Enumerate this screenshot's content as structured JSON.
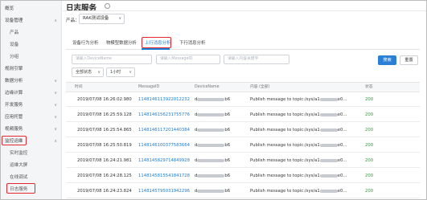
{
  "sidebar": {
    "items": [
      {
        "label": "概览",
        "indent": false,
        "chev": ""
      },
      {
        "label": "设备管理",
        "indent": false,
        "chev": "∧"
      },
      {
        "label": "产品",
        "indent": true,
        "chev": ""
      },
      {
        "label": "设备",
        "indent": true,
        "chev": ""
      },
      {
        "label": "分组",
        "indent": true,
        "chev": ""
      },
      {
        "label": "规则引擎",
        "indent": false,
        "chev": ""
      },
      {
        "label": "数据分析",
        "indent": false,
        "chev": "∨"
      },
      {
        "label": "边缘计算",
        "indent": false,
        "chev": "∨"
      },
      {
        "label": "开发服务",
        "indent": false,
        "chev": "∨"
      },
      {
        "label": "应用托管",
        "indent": false,
        "chev": "∨"
      },
      {
        "label": "视频服务",
        "indent": false,
        "chev": "∨"
      },
      {
        "label": "监控运维",
        "indent": false,
        "chev": "∧"
      },
      {
        "label": "实时监控",
        "indent": true,
        "chev": ""
      },
      {
        "label": "运维大屏",
        "indent": true,
        "chev": ""
      },
      {
        "label": "在线调试",
        "indent": true,
        "chev": ""
      },
      {
        "label": "日志服务",
        "indent": true,
        "chev": ""
      }
    ]
  },
  "header": {
    "title": "日志服务",
    "product_label": "产品：",
    "product_value": "RAK测试设备"
  },
  "tabs": [
    {
      "label": "设备行为分析",
      "active": false
    },
    {
      "label": "物模型数据分析",
      "active": false
    },
    {
      "label": "上行消息分析",
      "active": true
    },
    {
      "label": "下行消息分析",
      "active": false
    }
  ],
  "filters": {
    "devicename_placeholder": "请输入DeviceName",
    "messageid_placeholder": "请输入MessageID",
    "content_placeholder": "请输入内容关键字",
    "status_value": "全部状态",
    "time_value": "1小时",
    "search_label": "搜索",
    "reset_label": "重置"
  },
  "table": {
    "headers": {
      "time": "时间",
      "messageid": "MessageID",
      "devicename": "DeviceName",
      "content": "内容 (全部)",
      "status": "状态"
    },
    "rows": [
      {
        "time": "2019/07/08 16:26:02.980",
        "messageid": "1148146113922012232",
        "device_prefix": "d",
        "device_suffix": "b6",
        "content_prefix": "Publish message to topic:/sys/a1",
        "content_suffix": "e0...",
        "status": "200"
      },
      {
        "time": "2019/07/08 16:25:59.128",
        "messageid": "1148146156231755776",
        "device_prefix": "d",
        "device_suffix": "b6",
        "content_prefix": "Publish message to topic:/sys/a1",
        "content_suffix": "e0...",
        "status": "200"
      },
      {
        "time": "2019/07/08 16:25:54.865",
        "messageid": "1148146117201440384",
        "device_prefix": "d",
        "device_suffix": "b6",
        "content_prefix": "Publish message to topic:/sys/a1",
        "content_suffix": "e0...",
        "status": "200"
      },
      {
        "time": "2019/07/08 16:25:50.819",
        "messageid": "1148146100377583664",
        "device_prefix": "d",
        "device_suffix": "b6",
        "content_prefix": "Publish message to topic:/sys/a1",
        "content_suffix": "e0...",
        "status": "200"
      },
      {
        "time": "2019/07/08 16:24:21.981",
        "messageid": "1148145829714849928",
        "device_prefix": "d",
        "device_suffix": "b6",
        "content_prefix": "Publish message to topic:/sys/a1",
        "content_suffix": "e0...",
        "status": "200"
      },
      {
        "time": "2019/07/08 16:24:28.125",
        "messageid": "1148145815541841728",
        "device_prefix": "d",
        "device_suffix": "b6",
        "content_prefix": "Publish message to topic:/sys/a1",
        "content_suffix": "e0...",
        "status": "200"
      },
      {
        "time": "2019/07/08 16:24:23.824",
        "messageid": "1148145795031942296",
        "device_prefix": "d",
        "device_suffix": "b6",
        "content_prefix": "Publish message to topic:/sys/a1",
        "content_suffix": "e0...",
        "status": "200"
      }
    ]
  },
  "colors": {
    "accent": "#1a7dd6",
    "highlight": "#e3262f",
    "status_ok": "#2f9b35"
  }
}
